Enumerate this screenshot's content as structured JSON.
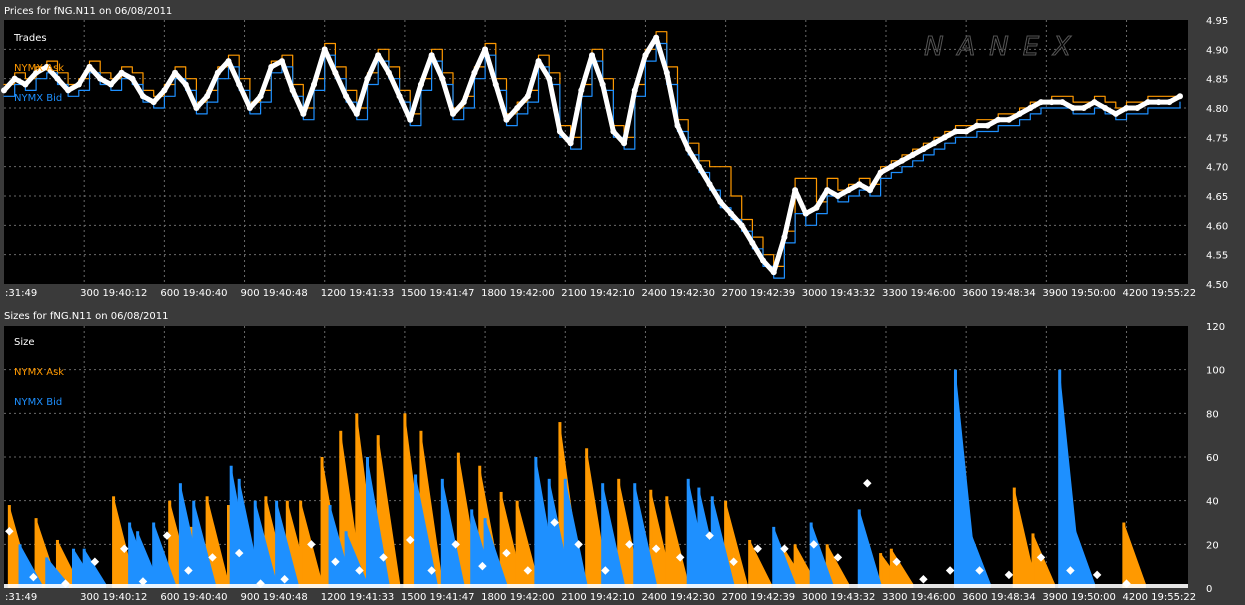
{
  "watermark": "NANEX",
  "colors": {
    "frame": "#3a3a3a",
    "plot_bg": "#000000",
    "grid": "#6a6a6a",
    "text": "#ffffff",
    "ask": "#ff9900",
    "bid": "#1e90ff",
    "trade": "#ffffff"
  },
  "chart_data": [
    {
      "type": "line",
      "panel_title": "Prices for  fNG.N11  on  06/08/2011",
      "legend": [
        "Trades",
        "NYMX Ask",
        "NYMX Bid"
      ],
      "legend_placement": "top-left",
      "x_tick_labels": [
        ":31:49",
        "300 19:40:12",
        "600 19:40:40",
        "900 19:40:48",
        "1200 19:41:33",
        "1500 19:41:47",
        "1800 19:42:00",
        "2100 19:42:10",
        "2400 19:42:30",
        "2700 19:42:39",
        "3000 19:43:32",
        "3300 19:46:00",
        "3600 19:48:34",
        "3900 19:50:00",
        "4200 19:55:22"
      ],
      "x_tick_values": [
        0,
        300,
        600,
        900,
        1200,
        1500,
        1800,
        2100,
        2400,
        2700,
        3000,
        3300,
        3600,
        3900,
        4200
      ],
      "xlim": [
        0,
        4430
      ],
      "ylim": [
        4.5,
        4.95
      ],
      "y_ticks": [
        "4.50",
        "4.55",
        "4.60",
        "4.65",
        "4.70",
        "4.75",
        "4.80",
        "4.85",
        "4.90",
        "4.95"
      ],
      "grid": true,
      "series": [
        {
          "name": "Trades",
          "x": [
            0,
            40,
            80,
            120,
            160,
            200,
            240,
            280,
            320,
            360,
            400,
            440,
            480,
            520,
            560,
            600,
            640,
            680,
            720,
            760,
            800,
            840,
            880,
            920,
            960,
            1000,
            1040,
            1080,
            1120,
            1160,
            1200,
            1240,
            1280,
            1320,
            1360,
            1400,
            1440,
            1480,
            1520,
            1560,
            1600,
            1640,
            1680,
            1720,
            1760,
            1800,
            1840,
            1880,
            1920,
            1960,
            2000,
            2040,
            2080,
            2120,
            2160,
            2200,
            2240,
            2280,
            2320,
            2360,
            2400,
            2440,
            2480,
            2520,
            2560,
            2600,
            2640,
            2680,
            2720,
            2760,
            2800,
            2840,
            2880,
            2920,
            2960,
            3000,
            3040,
            3080,
            3120,
            3160,
            3200,
            3240,
            3280,
            3320,
            3360,
            3400,
            3440,
            3480,
            3520,
            3560,
            3600,
            3640,
            3680,
            3720,
            3760,
            3800,
            3840,
            3880,
            3920,
            3960,
            4000,
            4040,
            4080,
            4120,
            4160,
            4200,
            4240,
            4280,
            4320,
            4360,
            4400
          ],
          "values": [
            4.83,
            4.85,
            4.84,
            4.86,
            4.87,
            4.85,
            4.83,
            4.84,
            4.87,
            4.85,
            4.84,
            4.86,
            4.85,
            4.82,
            4.81,
            4.83,
            4.86,
            4.84,
            4.8,
            4.82,
            4.86,
            4.88,
            4.84,
            4.8,
            4.82,
            4.87,
            4.88,
            4.83,
            4.79,
            4.84,
            4.9,
            4.86,
            4.82,
            4.79,
            4.85,
            4.89,
            4.86,
            4.82,
            4.78,
            4.84,
            4.89,
            4.85,
            4.79,
            4.81,
            4.86,
            4.9,
            4.84,
            4.78,
            4.8,
            4.82,
            4.88,
            4.85,
            4.76,
            4.74,
            4.83,
            4.89,
            4.84,
            4.76,
            4.74,
            4.83,
            4.89,
            4.92,
            4.86,
            4.77,
            4.73,
            4.7,
            4.67,
            4.64,
            4.62,
            4.6,
            4.57,
            4.54,
            4.52,
            4.58,
            4.66,
            4.62,
            4.63,
            4.66,
            4.65,
            4.66,
            4.67,
            4.66,
            4.69,
            4.7,
            4.71,
            4.72,
            4.73,
            4.74,
            4.75,
            4.76,
            4.76,
            4.77,
            4.77,
            4.78,
            4.78,
            4.79,
            4.8,
            4.81,
            4.81,
            4.81,
            4.8,
            4.8,
            4.81,
            4.8,
            4.79,
            4.8,
            4.8,
            4.81,
            4.81,
            4.81,
            4.82
          ]
        },
        {
          "name": "NYMX Ask",
          "x": [
            0,
            40,
            80,
            120,
            160,
            200,
            240,
            280,
            320,
            360,
            400,
            440,
            480,
            520,
            560,
            600,
            640,
            680,
            720,
            760,
            800,
            840,
            880,
            920,
            960,
            1000,
            1040,
            1080,
            1120,
            1160,
            1200,
            1240,
            1280,
            1320,
            1360,
            1400,
            1440,
            1480,
            1520,
            1560,
            1600,
            1640,
            1680,
            1720,
            1760,
            1800,
            1840,
            1880,
            1920,
            1960,
            2000,
            2040,
            2080,
            2120,
            2160,
            2200,
            2240,
            2280,
            2320,
            2360,
            2400,
            2440,
            2480,
            2520,
            2560,
            2600,
            2640,
            2680,
            2720,
            2760,
            2800,
            2840,
            2880,
            2920,
            2960,
            3000,
            3040,
            3080,
            3120,
            3160,
            3200,
            3240,
            3280,
            3320,
            3360,
            3400,
            3440,
            3480,
            3520,
            3560,
            3600,
            3640,
            3680,
            3720,
            3760,
            3800,
            3840,
            3880,
            3920,
            3960,
            4000,
            4040,
            4080,
            4120,
            4160,
            4200,
            4240,
            4280,
            4320,
            4360,
            4400
          ],
          "values": [
            4.84,
            4.86,
            4.85,
            4.87,
            4.88,
            4.86,
            4.84,
            4.85,
            4.88,
            4.86,
            4.85,
            4.87,
            4.86,
            4.83,
            4.82,
            4.84,
            4.87,
            4.85,
            4.81,
            4.83,
            4.87,
            4.89,
            4.85,
            4.81,
            4.83,
            4.88,
            4.89,
            4.84,
            4.8,
            4.85,
            4.91,
            4.87,
            4.83,
            4.8,
            4.86,
            4.9,
            4.87,
            4.83,
            4.79,
            4.85,
            4.9,
            4.86,
            4.8,
            4.82,
            4.87,
            4.91,
            4.85,
            4.79,
            4.81,
            4.83,
            4.89,
            4.86,
            4.77,
            4.75,
            4.84,
            4.9,
            4.85,
            4.77,
            4.75,
            4.84,
            4.9,
            4.93,
            4.87,
            4.78,
            4.74,
            4.71,
            4.7,
            4.7,
            4.65,
            4.61,
            4.58,
            4.55,
            4.53,
            4.59,
            4.68,
            4.68,
            4.64,
            4.68,
            4.66,
            4.67,
            4.68,
            4.67,
            4.7,
            4.71,
            4.72,
            4.73,
            4.74,
            4.75,
            4.76,
            4.77,
            4.77,
            4.78,
            4.78,
            4.79,
            4.79,
            4.8,
            4.81,
            4.81,
            4.82,
            4.82,
            4.81,
            4.81,
            4.82,
            4.81,
            4.8,
            4.81,
            4.81,
            4.82,
            4.82,
            4.82,
            4.82
          ]
        },
        {
          "name": "NYMX Bid",
          "x": [
            0,
            40,
            80,
            120,
            160,
            200,
            240,
            280,
            320,
            360,
            400,
            440,
            480,
            520,
            560,
            600,
            640,
            680,
            720,
            760,
            800,
            840,
            880,
            920,
            960,
            1000,
            1040,
            1080,
            1120,
            1160,
            1200,
            1240,
            1280,
            1320,
            1360,
            1400,
            1440,
            1480,
            1520,
            1560,
            1600,
            1640,
            1680,
            1720,
            1760,
            1800,
            1840,
            1880,
            1920,
            1960,
            2000,
            2040,
            2080,
            2120,
            2160,
            2200,
            2240,
            2280,
            2320,
            2360,
            2400,
            2440,
            2480,
            2520,
            2560,
            2600,
            2640,
            2680,
            2720,
            2760,
            2800,
            2840,
            2880,
            2920,
            2960,
            3000,
            3040,
            3080,
            3120,
            3160,
            3200,
            3240,
            3280,
            3320,
            3360,
            3400,
            3440,
            3480,
            3520,
            3560,
            3600,
            3640,
            3680,
            3720,
            3760,
            3800,
            3840,
            3880,
            3920,
            3960,
            4000,
            4040,
            4080,
            4120,
            4160,
            4200,
            4240,
            4280,
            4320,
            4360,
            4400
          ],
          "values": [
            4.82,
            4.84,
            4.83,
            4.85,
            4.86,
            4.84,
            4.82,
            4.83,
            4.86,
            4.84,
            4.83,
            4.85,
            4.84,
            4.81,
            4.8,
            4.82,
            4.85,
            4.83,
            4.79,
            4.81,
            4.85,
            4.87,
            4.83,
            4.79,
            4.81,
            4.86,
            4.87,
            4.82,
            4.78,
            4.83,
            4.89,
            4.85,
            4.81,
            4.78,
            4.84,
            4.88,
            4.85,
            4.81,
            4.77,
            4.83,
            4.88,
            4.84,
            4.78,
            4.8,
            4.85,
            4.89,
            4.83,
            4.77,
            4.79,
            4.81,
            4.87,
            4.84,
            4.75,
            4.73,
            4.82,
            4.88,
            4.83,
            4.75,
            4.73,
            4.82,
            4.88,
            4.91,
            4.84,
            4.76,
            4.72,
            4.69,
            4.66,
            4.63,
            4.61,
            4.59,
            4.56,
            4.53,
            4.51,
            4.57,
            4.62,
            4.6,
            4.62,
            4.65,
            4.64,
            4.65,
            4.66,
            4.65,
            4.68,
            4.69,
            4.7,
            4.71,
            4.72,
            4.73,
            4.74,
            4.75,
            4.75,
            4.76,
            4.76,
            4.77,
            4.77,
            4.78,
            4.79,
            4.8,
            4.8,
            4.8,
            4.79,
            4.79,
            4.8,
            4.79,
            4.78,
            4.79,
            4.79,
            4.8,
            4.8,
            4.8,
            4.81
          ]
        }
      ]
    },
    {
      "type": "bar",
      "panel_title": "Sizes for  fNG.N11  on  06/08/2011",
      "legend": [
        "Size",
        "NYMX Ask",
        "NYMX Bid"
      ],
      "legend_placement": "top-left",
      "x_tick_labels": [
        ":31:49",
        "300 19:40:12",
        "600 19:40:40",
        "900 19:40:48",
        "1200 19:41:33",
        "1500 19:41:47",
        "1800 19:42:00",
        "2100 19:42:10",
        "2400 19:42:30",
        "2700 19:42:39",
        "3000 19:43:32",
        "3300 19:46:00",
        "3600 19:48:34",
        "3900 19:50:00",
        "4200 19:55:22"
      ],
      "x_tick_values": [
        0,
        300,
        600,
        900,
        1200,
        1500,
        1800,
        2100,
        2400,
        2700,
        3000,
        3300,
        3600,
        3900,
        4200
      ],
      "xlim": [
        0,
        4430
      ],
      "ylim": [
        0,
        120
      ],
      "y_ticks": [
        "0",
        "20",
        "40",
        "60",
        "80",
        "100",
        "120"
      ],
      "grid": true,
      "series": [
        {
          "name": "NYMX Ask",
          "x": [
            20,
            120,
            200,
            410,
            620,
            700,
            760,
            840,
            980,
            1060,
            1110,
            1190,
            1260,
            1320,
            1400,
            1500,
            1560,
            1700,
            1780,
            1860,
            1920,
            2080,
            2180,
            2300,
            2420,
            2480,
            2700,
            2790,
            2920,
            2960,
            3080,
            3280,
            3320,
            3780,
            3850,
            4190
          ],
          "values": [
            38,
            32,
            22,
            42,
            40,
            28,
            42,
            38,
            42,
            40,
            40,
            60,
            72,
            80,
            70,
            80,
            72,
            62,
            56,
            44,
            40,
            76,
            64,
            50,
            45,
            42,
            40,
            22,
            18,
            20,
            20,
            16,
            18,
            46,
            25,
            30
          ]
        },
        {
          "name": "NYMX Bid",
          "x": [
            60,
            160,
            260,
            300,
            470,
            500,
            560,
            660,
            710,
            850,
            880,
            940,
            1020,
            1220,
            1280,
            1360,
            1540,
            1640,
            1750,
            1800,
            1990,
            2040,
            2100,
            2240,
            2360,
            2560,
            2600,
            2650,
            2880,
            3020,
            3200,
            3560,
            3610,
            3950,
            4000
          ],
          "values": [
            20,
            14,
            18,
            18,
            30,
            26,
            30,
            48,
            40,
            56,
            50,
            40,
            40,
            38,
            26,
            60,
            52,
            50,
            36,
            32,
            60,
            50,
            50,
            48,
            48,
            50,
            46,
            42,
            28,
            30,
            36,
            100,
            28,
            100,
            30
          ]
        },
        {
          "name": "Trades",
          "x": [
            20,
            110,
            230,
            340,
            450,
            520,
            610,
            690,
            780,
            880,
            960,
            1050,
            1150,
            1240,
            1330,
            1420,
            1520,
            1600,
            1690,
            1790,
            1880,
            1960,
            2060,
            2150,
            2250,
            2340,
            2440,
            2530,
            2640,
            2730,
            2820,
            2920,
            3030,
            3120,
            3230,
            3340,
            3440,
            3540,
            3650,
            3760,
            3880,
            3990,
            4090,
            4200
          ],
          "values": [
            26,
            5,
            2,
            12,
            18,
            3,
            24,
            8,
            14,
            16,
            2,
            4,
            20,
            12,
            8,
            14,
            22,
            8,
            20,
            10,
            16,
            8,
            30,
            20,
            8,
            20,
            18,
            14,
            24,
            12,
            18,
            18,
            20,
            14,
            48,
            12,
            4,
            8,
            8,
            6,
            14,
            8,
            6,
            2
          ]
        }
      ]
    }
  ]
}
